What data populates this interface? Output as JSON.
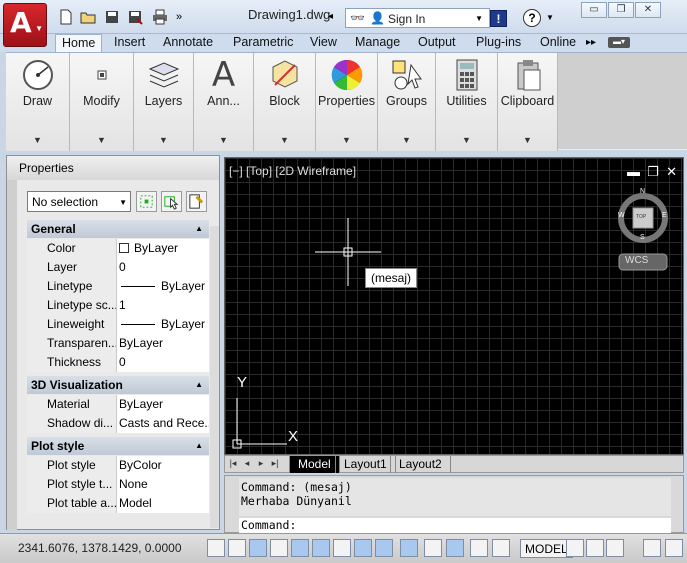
{
  "titlebar": {
    "document_title": "Drawing1.dwg",
    "search_placeholder": "Sign In",
    "exchange_label": "!",
    "help_label": "?"
  },
  "ribbon": {
    "tabs": [
      "Home",
      "Insert",
      "Annotate",
      "Parametric",
      "View",
      "Manage",
      "Output",
      "Plug-ins",
      "Online"
    ],
    "active_tab": "Home",
    "panels": [
      {
        "label": "Draw",
        "icon": "circle-icon"
      },
      {
        "label": "Modify",
        "icon": "modify-icon"
      },
      {
        "label": "Layers",
        "icon": "layers-icon"
      },
      {
        "label": "Ann...",
        "icon": "text-icon"
      },
      {
        "label": "Block",
        "icon": "block-icon"
      },
      {
        "label": "Properties",
        "icon": "color-wheel-icon"
      },
      {
        "label": "Groups",
        "icon": "groups-icon"
      },
      {
        "label": "Utilities",
        "icon": "calculator-icon"
      },
      {
        "label": "Clipboard",
        "icon": "clipboard-icon"
      }
    ]
  },
  "properties": {
    "title": "Properties",
    "selection": "No selection",
    "sections": {
      "general": {
        "title": "General",
        "rows": [
          {
            "key": "Color",
            "value": "ByLayer"
          },
          {
            "key": "Layer",
            "value": "0"
          },
          {
            "key": "Linetype",
            "value": "ByLayer"
          },
          {
            "key": "Linetype sc...",
            "value": "1"
          },
          {
            "key": "Lineweight",
            "value": "ByLayer"
          },
          {
            "key": "Transparen...",
            "value": "ByLayer"
          },
          {
            "key": "Thickness",
            "value": "0"
          }
        ]
      },
      "visualization": {
        "title": "3D Visualization",
        "rows": [
          {
            "key": "Material",
            "value": "ByLayer"
          },
          {
            "key": "Shadow di...",
            "value": "Casts and Rece..."
          }
        ]
      },
      "plot": {
        "title": "Plot style",
        "rows": [
          {
            "key": "Plot style",
            "value": "ByColor"
          },
          {
            "key": "Plot style t...",
            "value": "None"
          },
          {
            "key": "Plot table a...",
            "value": "Model"
          }
        ]
      }
    }
  },
  "viewport": {
    "label": "[−] [Top] [2D Wireframe]",
    "tooltip": "(mesaj)",
    "viewcube": {
      "top": "TOP",
      "n": "N",
      "s": "S",
      "e": "E",
      "w": "W",
      "wcs": "WCS"
    },
    "ucs": {
      "x": "X",
      "y": "Y"
    }
  },
  "layout_tabs": [
    "Model",
    "Layout1",
    "Layout2"
  ],
  "command": {
    "history": [
      "Command: (mesaj)",
      "Merhaba Dünyanil"
    ],
    "prompt": "Command:"
  },
  "status": {
    "coords": "2341.6076, 1378.1429, 0.0000",
    "model_label": "MODEL"
  }
}
